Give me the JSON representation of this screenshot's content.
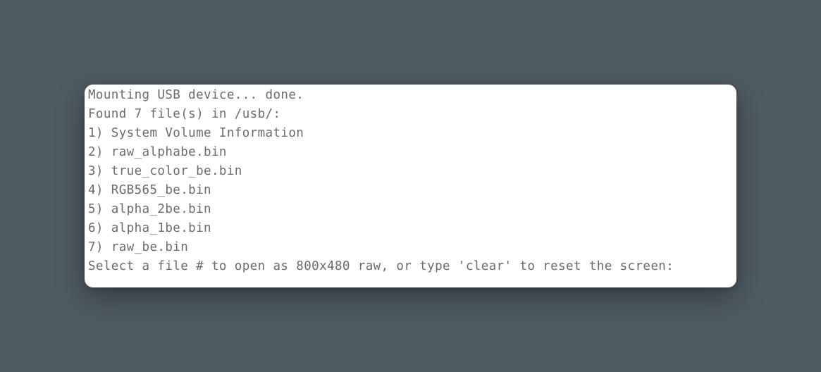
{
  "terminal": {
    "lines": [
      "Mounting USB device... done.",
      "Found 7 file(s) in /usb/:",
      "1) System Volume Information",
      "2) raw_alphabe.bin",
      "3) true_color_be.bin",
      "4) RGB565_be.bin",
      "5) alpha_2be.bin",
      "6) alpha_1be.bin",
      "7) raw_be.bin"
    ],
    "prompt": "Select a file # to open as 800x480 raw, or type 'clear' to reset the screen:",
    "input_value": ""
  },
  "colors": {
    "background": "#4f5b62",
    "terminal_bg": "#ffffff",
    "text": "#6b6b6b"
  }
}
